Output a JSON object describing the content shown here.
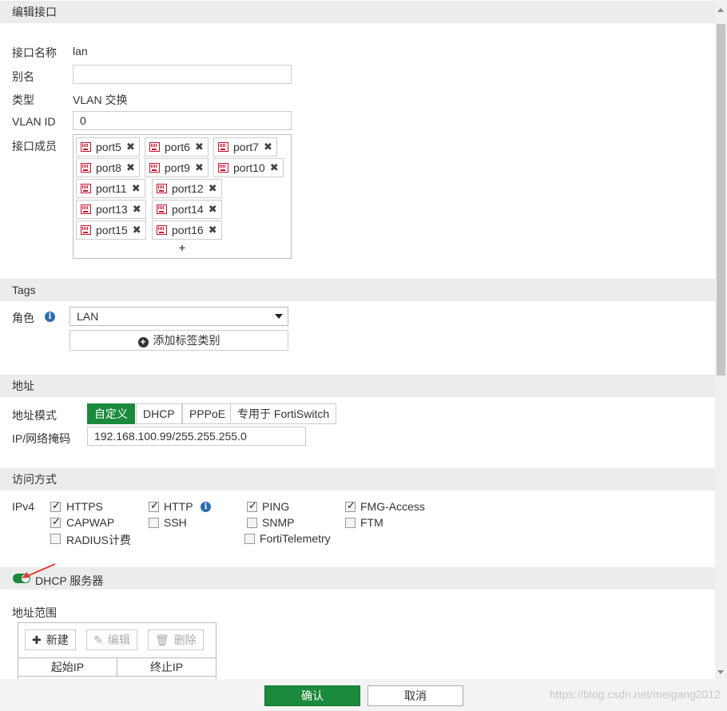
{
  "sections": {
    "edit_interface": "编辑接口",
    "tags": "Tags",
    "address": "地址",
    "access": "访问方式",
    "dhcp": "DHCP 服务器"
  },
  "interface": {
    "name_label": "接口名称",
    "name_value": "lan",
    "alias_label": "别名",
    "alias_value": "",
    "type_label": "类型",
    "type_value": "VLAN 交换",
    "vlan_label": "VLAN ID",
    "vlan_value": "0",
    "members_label": "接口成员",
    "members": [
      "port5",
      "port6",
      "port7",
      "port8",
      "port9",
      "port10",
      "port11",
      "port12",
      "port13",
      "port14",
      "port15",
      "port16"
    ],
    "remove_glyph": "✖",
    "add_glyph": "+"
  },
  "tags": {
    "role_label": "角色",
    "role_value": "LAN",
    "add_tag_label": "添加标签类别"
  },
  "address": {
    "mode_label": "地址模式",
    "modes": [
      "自定义",
      "DHCP",
      "PPPoE",
      "专用于 FortiSwitch"
    ],
    "active_mode": "自定义",
    "ipmask_label": "IP/网络掩码",
    "ipmask_value": "192.168.100.99/255.255.255.0"
  },
  "access": {
    "ipv4_label": "IPv4",
    "options": [
      {
        "label": "HTTPS",
        "checked": true
      },
      {
        "label": "HTTP",
        "checked": true
      },
      {
        "label": "PING",
        "checked": true
      },
      {
        "label": "FMG-Access",
        "checked": true
      },
      {
        "label": "CAPWAP",
        "checked": true
      },
      {
        "label": "SSH",
        "checked": false
      },
      {
        "label": "SNMP",
        "checked": false
      },
      {
        "label": "FTM",
        "checked": false
      },
      {
        "label": "RADIUS计费",
        "checked": false
      },
      {
        "label": "FortiTelemetry",
        "checked": false
      }
    ]
  },
  "dhcp": {
    "enabled": true,
    "range_label": "地址范围",
    "new_label": "新建",
    "edit_label": "编辑",
    "delete_label": "删除",
    "col_start": "起始IP",
    "col_end": "终止IP"
  },
  "footer": {
    "ok_label": "确认",
    "cancel_label": "取消",
    "watermark": "https://blog.csdn.net/meigang2012"
  },
  "colors": {
    "accent_green": "#1a8a3c",
    "port_icon_red": "#c8102e",
    "annotation_arrow": "#e53935",
    "info_blue": "#2b6cb0"
  }
}
